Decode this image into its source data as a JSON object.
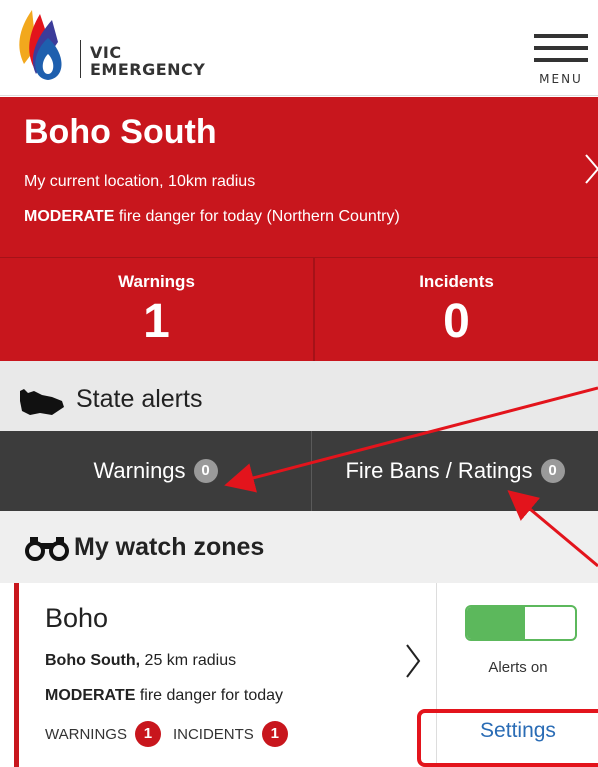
{
  "header": {
    "logo_line1": "VIC",
    "logo_line2": "EMERGENCY",
    "menu_label": "MENU"
  },
  "location": {
    "title": "Boho South",
    "subtitle": "My current location, 10km radius",
    "danger_level": "MODERATE",
    "danger_text": " fire danger for today (Northern Country)"
  },
  "counts": {
    "warnings_label": "Warnings",
    "warnings_value": "1",
    "incidents_label": "Incidents",
    "incidents_value": "0"
  },
  "state_alerts": {
    "title": "State alerts",
    "tabs": [
      {
        "label": "Warnings",
        "count": "0"
      },
      {
        "label": "Fire Bans / Ratings",
        "count": "0"
      }
    ]
  },
  "watch_zones": {
    "title": "My watch zones",
    "zone": {
      "name": "Boho",
      "location": "Boho South,",
      "radius": " 25 km radius",
      "danger_level": "MODERATE",
      "danger_text": " fire danger for today",
      "warnings_label": "WARNINGS",
      "warnings_count": "1",
      "incidents_label": "INCIDENTS",
      "incidents_count": "1",
      "alerts_status": "Alerts on",
      "alerts_enabled": true,
      "settings_label": "Settings"
    }
  },
  "colors": {
    "brand_red": "#c8161d",
    "dark_tab": "#3c3c3c",
    "toggle_green": "#5cb85c",
    "link_blue": "#2a6cb5",
    "annotation_red": "#e3141c"
  }
}
